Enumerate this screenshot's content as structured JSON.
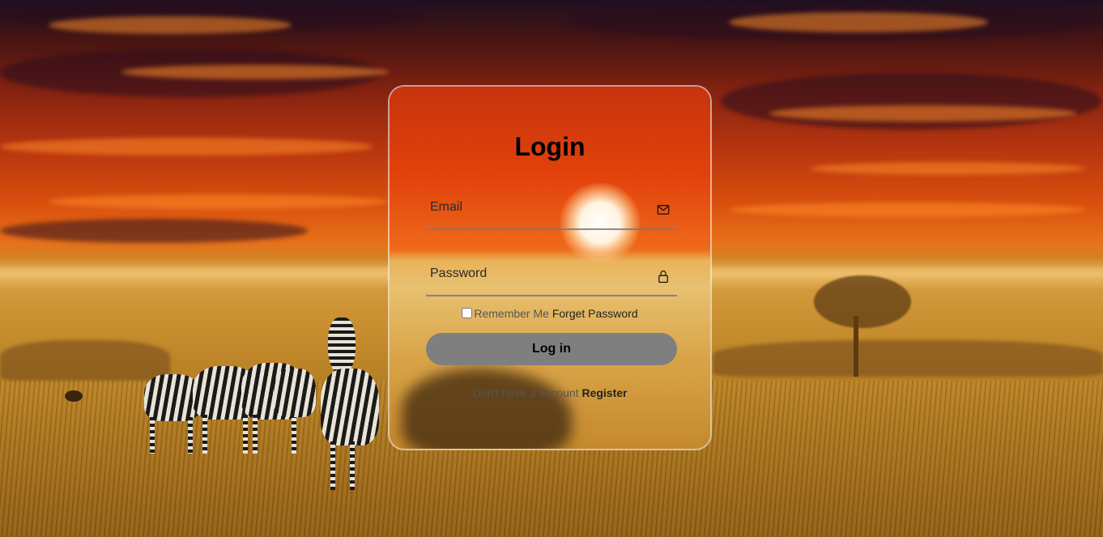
{
  "login": {
    "title": "Login",
    "email_placeholder": "Email",
    "email_icon": "envelope-icon",
    "password_placeholder": "Password",
    "password_icon": "lock-icon",
    "remember_label": "Remember Me",
    "remember_checked": false,
    "forget_label": "Forget Password",
    "submit_label": "Log in",
    "no_account_text": "Don't have a account",
    "register_label": "Register"
  },
  "colors": {
    "button_bg": "#7f7f7f",
    "card_border": "#ffffff"
  }
}
